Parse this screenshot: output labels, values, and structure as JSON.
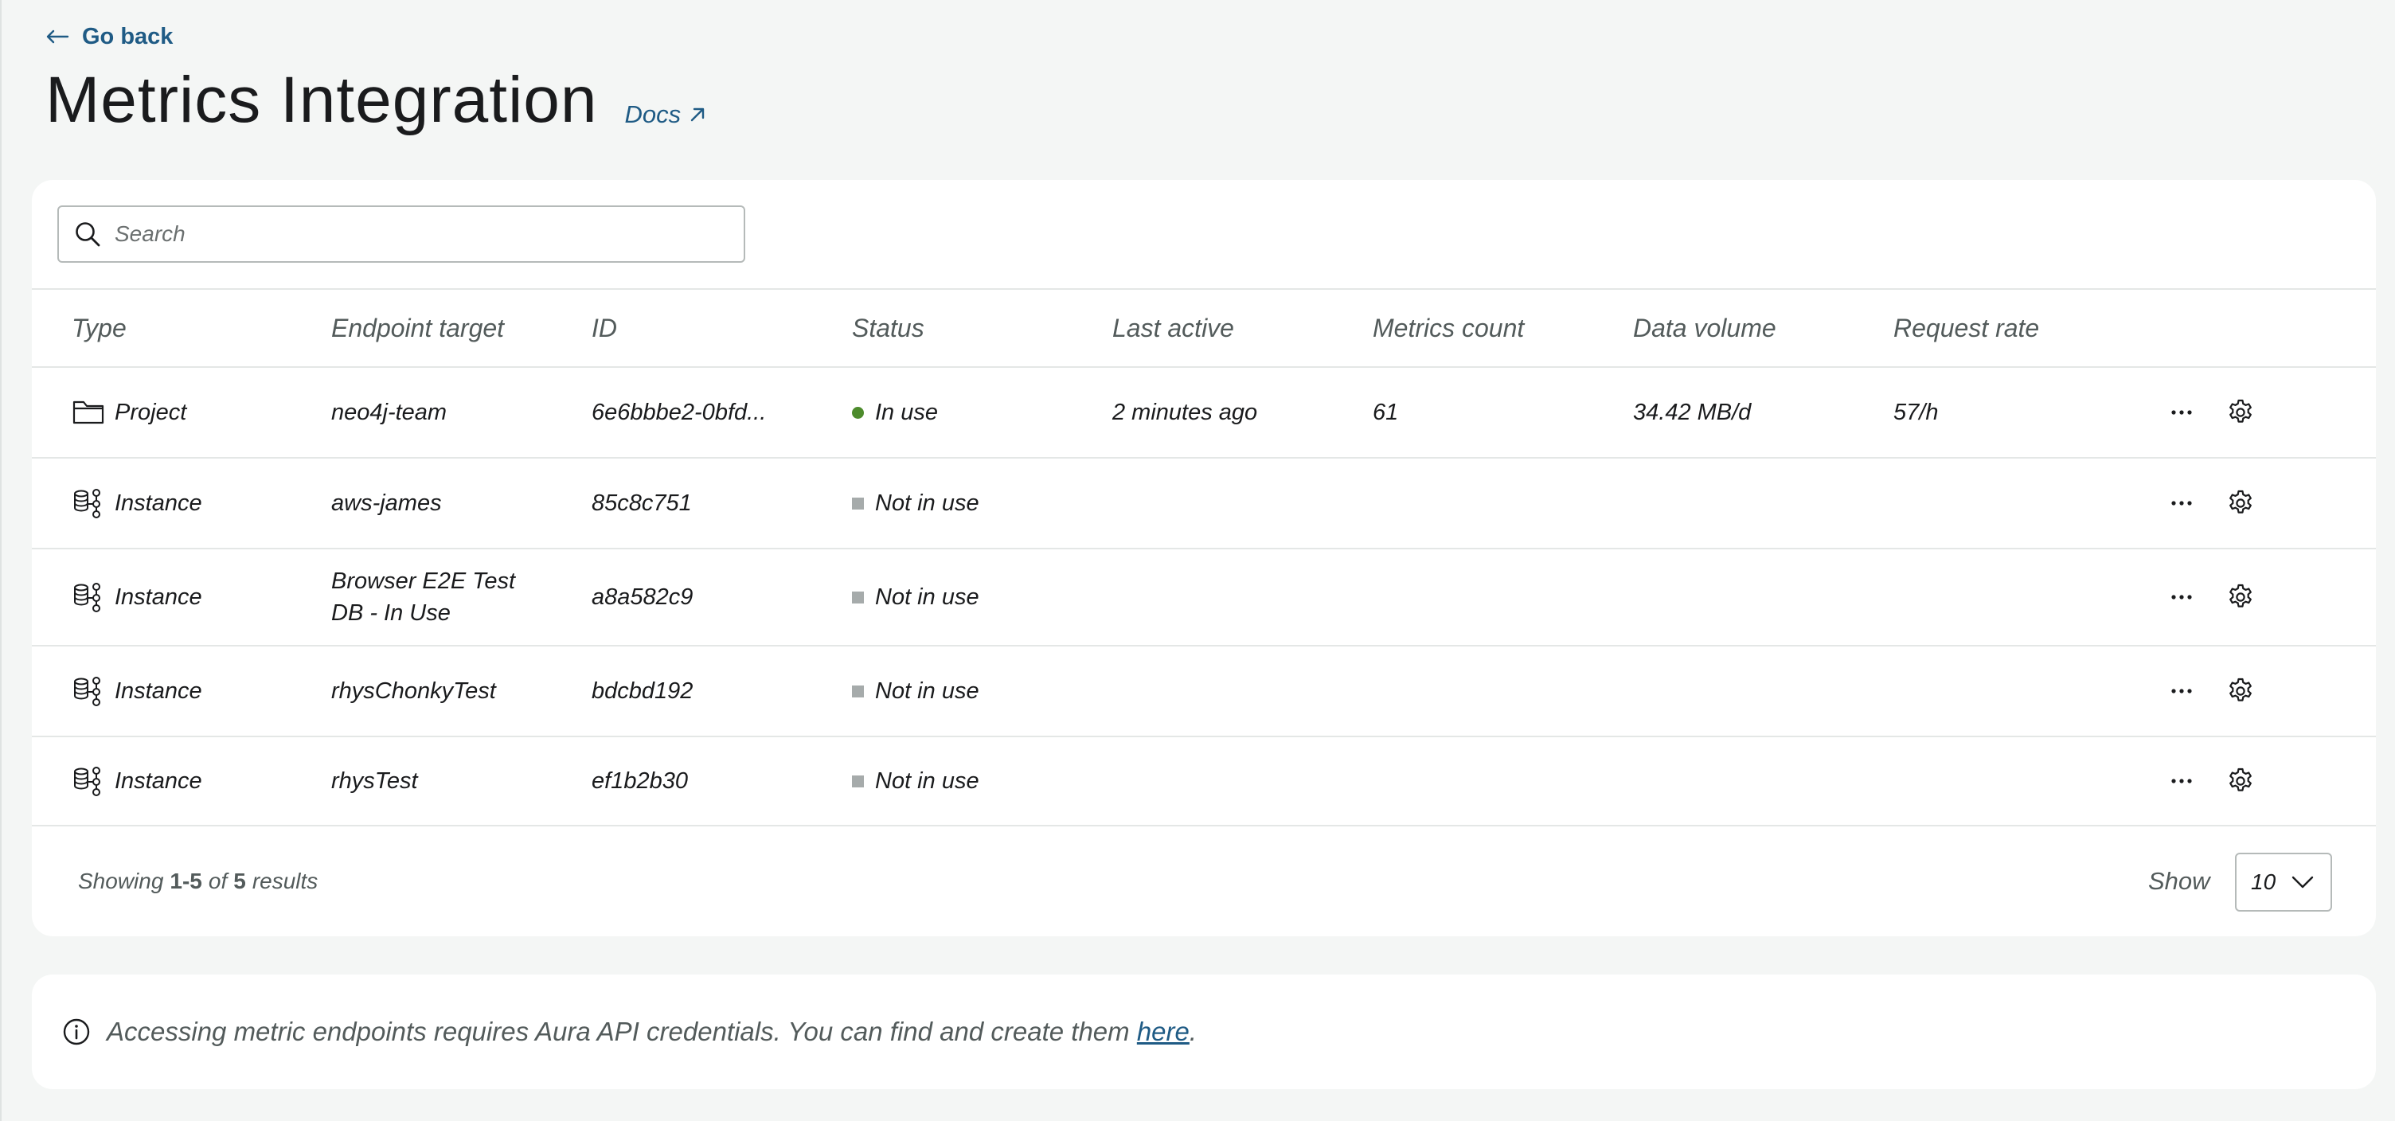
{
  "header": {
    "go_back_label": "Go back",
    "title": "Metrics Integration",
    "docs_label": "Docs"
  },
  "search": {
    "placeholder": "Search",
    "value": ""
  },
  "table": {
    "columns": [
      "Type",
      "Endpoint target",
      "ID",
      "Status",
      "Last active",
      "Metrics count",
      "Data volume",
      "Request rate"
    ],
    "rows": [
      {
        "type": "Project",
        "type_icon": "folder-icon",
        "endpoint": "neo4j-team",
        "id": "6e6bbbe2-0bfd...",
        "status": "In use",
        "status_color": "#4d8b2c",
        "last_active": "2 minutes ago",
        "metrics_count": "61",
        "data_volume": "34.42 MB/d",
        "request_rate": "57/h"
      },
      {
        "type": "Instance",
        "type_icon": "database-instance-icon",
        "endpoint": "aws-james",
        "id": "85c8c751",
        "status": "Not in use",
        "status_color": "#a6abab",
        "last_active": "",
        "metrics_count": "",
        "data_volume": "",
        "request_rate": ""
      },
      {
        "type": "Instance",
        "type_icon": "database-instance-icon",
        "endpoint_line1": "Browser E2E Test",
        "endpoint_line2": "DB - In Use",
        "id": "a8a582c9",
        "status": "Not in use",
        "status_color": "#a6abab",
        "last_active": "",
        "metrics_count": "",
        "data_volume": "",
        "request_rate": ""
      },
      {
        "type": "Instance",
        "type_icon": "database-instance-icon",
        "endpoint": "rhysChonkyTest",
        "id": "bdcbd192",
        "status": "Not in use",
        "status_color": "#a6abab",
        "last_active": "",
        "metrics_count": "",
        "data_volume": "",
        "request_rate": ""
      },
      {
        "type": "Instance",
        "type_icon": "database-instance-icon",
        "endpoint": "rhysTest",
        "id": "ef1b2b30",
        "status": "Not in use",
        "status_color": "#a6abab",
        "last_active": "",
        "metrics_count": "",
        "data_volume": "",
        "request_rate": ""
      }
    ]
  },
  "pagination": {
    "showing_prefix": "Showing",
    "range": "1-5",
    "of_label": "of",
    "total": "5",
    "results_label": "results",
    "show_label": "Show",
    "page_size": "10"
  },
  "info": {
    "message": "Accessing metric endpoints requires Aura API credentials. You can find and create them",
    "link_label": "here",
    "suffix": "."
  },
  "colors": {
    "link": "#1f5b85",
    "status_in_use": "#4d8b2c",
    "status_not_in_use": "#a6abab",
    "background": "#f4f6f5"
  }
}
